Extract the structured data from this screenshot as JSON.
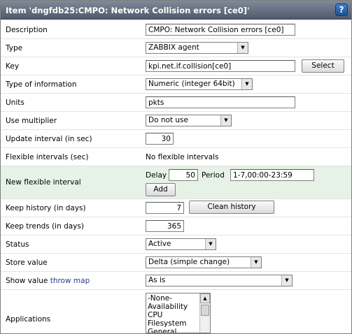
{
  "window": {
    "title": "Item 'dngfdb25:CMPO: Network Collision errors [ce0]'",
    "help_icon": "?"
  },
  "fields": {
    "description": {
      "label": "Description",
      "value": "CMPO: Network Collision errors [ce0]"
    },
    "type": {
      "label": "Type",
      "value": "ZABBIX agent"
    },
    "key": {
      "label": "Key",
      "value": "kpi.net.if.collision[ce0]",
      "button": "Select"
    },
    "type_of_information": {
      "label": "Type of information",
      "value": "Numeric (integer 64bit)"
    },
    "units": {
      "label": "Units",
      "value": "pkts"
    },
    "use_multiplier": {
      "label": "Use multiplier",
      "value": "Do not use"
    },
    "update_interval": {
      "label": "Update interval (in sec)",
      "value": "30"
    },
    "flexible_intervals": {
      "label": "Flexible intervals (sec)",
      "value": "No flexible intervals"
    },
    "new_flexible_interval": {
      "label": "New flexible interval",
      "delay_label": "Delay",
      "delay_value": "50",
      "period_label": "Period",
      "period_value": "1-7,00:00-23:59",
      "add_button": "Add"
    },
    "keep_history": {
      "label": "Keep history (in days)",
      "value": "7",
      "button": "Clean history"
    },
    "keep_trends": {
      "label": "Keep trends (in days)",
      "value": "365"
    },
    "status": {
      "label": "Status",
      "value": "Active"
    },
    "store_value": {
      "label": "Store value",
      "value": "Delta (simple change)"
    },
    "show_value": {
      "label": "Show value",
      "link": "throw map",
      "value": "As is"
    },
    "applications": {
      "label": "Applications",
      "options": [
        "-None-",
        "Availability",
        "CPU",
        "Filesystem",
        "General"
      ]
    }
  }
}
